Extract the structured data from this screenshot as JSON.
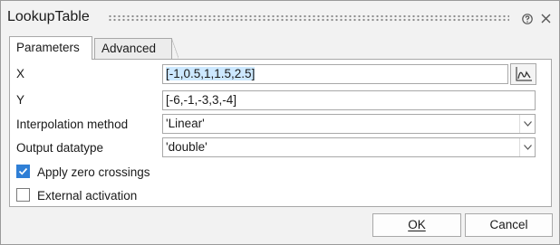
{
  "window": {
    "title": "LookupTable"
  },
  "icons": {
    "help": "help-circle-icon",
    "close": "close-icon",
    "plot": "plot-curve-icon",
    "dropdown": "chevron-down-icon",
    "check": "checkmark-icon"
  },
  "tabs": [
    {
      "label": "Parameters",
      "active": true
    },
    {
      "label": "Advanced",
      "active": false
    }
  ],
  "params": {
    "x": {
      "label": "X",
      "value": "[-1,0.5,1,1.5,2.5]"
    },
    "y": {
      "label": "Y",
      "value": "[-6,-1,-3,3,-4]"
    },
    "interp": {
      "label": "Interpolation method",
      "value": "'Linear'"
    },
    "dtype": {
      "label": "Output datatype",
      "value": "'double'"
    },
    "zero_crossings": {
      "label": "Apply zero crossings",
      "checked": true
    },
    "external": {
      "label": "External activation",
      "checked": false
    }
  },
  "buttons": {
    "ok": "OK",
    "cancel": "Cancel"
  },
  "colors": {
    "accent": "#2f7fd6",
    "selection": "#cce8ff"
  }
}
